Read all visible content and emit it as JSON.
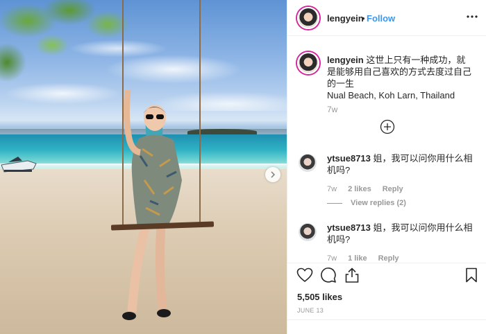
{
  "post": {
    "username": "lengyein",
    "follow_label": "Follow",
    "separator": "•",
    "caption": "这世上只有一种成功，就是能够用自己喜欢的方式去度过自己的一生",
    "location_text": "Nual Beach, Koh Larn, Thailand",
    "caption_time": "7w",
    "likes": "5,505 likes",
    "date": "JUNE 13"
  },
  "comments": [
    {
      "username": "ytsue8713",
      "text": "姐，我可以问你用什么相机吗?",
      "time": "7w",
      "likes": "2 likes",
      "reply_label": "Reply",
      "view_replies": "View replies (2)"
    },
    {
      "username": "ytsue8713",
      "text": "姐，我可以问你用什么相机吗?",
      "time": "7w",
      "likes": "1 like",
      "reply_label": "Reply"
    }
  ],
  "icons": {
    "more": "more-options-icon",
    "load_more": "plus-circle-icon",
    "like": "heart-icon",
    "comment": "comment-bubble-icon",
    "share": "share-icon",
    "save": "bookmark-icon",
    "next": "chevron-right-icon"
  },
  "colors": {
    "follow": "#3897f0",
    "text": "#262626",
    "muted": "#999999",
    "divider": "#efefef",
    "story_ring": "#d6249f"
  }
}
